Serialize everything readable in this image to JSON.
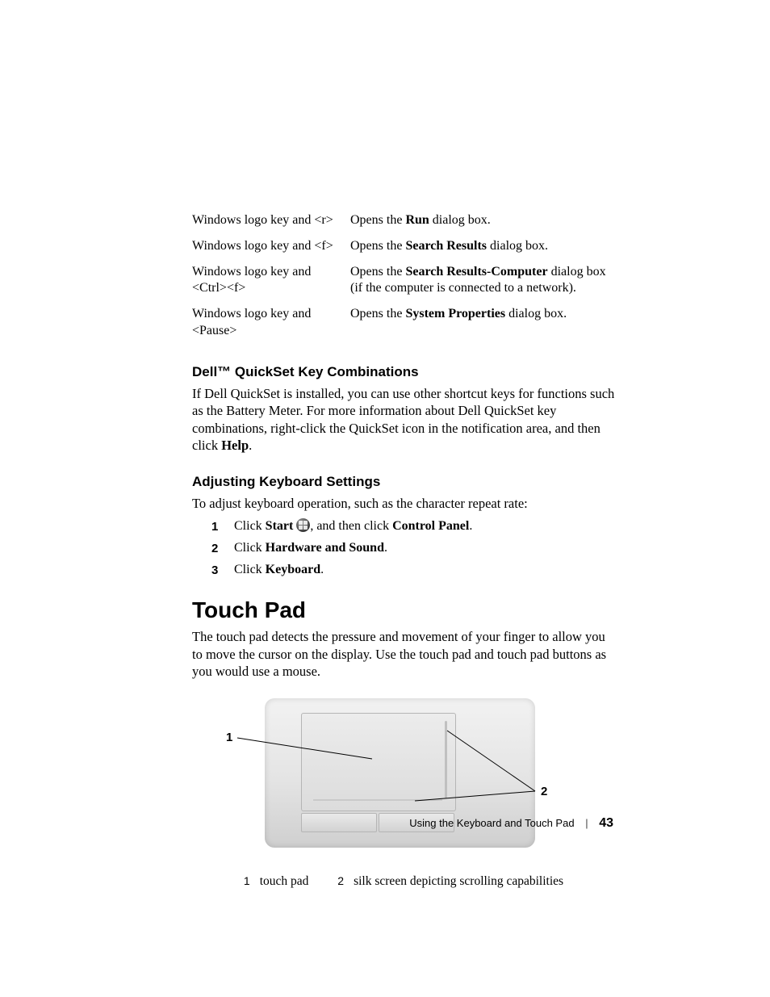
{
  "shortcuts": [
    {
      "keys": "Windows logo key and <r>",
      "desc_pre": "Opens the ",
      "desc_bold": "Run",
      "desc_post": " dialog box."
    },
    {
      "keys": "Windows logo key and <f>",
      "desc_pre": "Opens the ",
      "desc_bold": "Search Results",
      "desc_post": " dialog box."
    },
    {
      "keys": "Windows logo key and <Ctrl><f>",
      "desc_pre": "Opens the ",
      "desc_bold": "Search Results-Computer",
      "desc_post": " dialog box (if the computer is connected to a network)."
    },
    {
      "keys": "Windows logo key and <Pause>",
      "desc_pre": "Opens the ",
      "desc_bold": "System Properties",
      "desc_post": " dialog box."
    }
  ],
  "quickset": {
    "heading": "Dell™ QuickSet Key Combinations",
    "body_pre": "If Dell QuickSet is installed, you can use other shortcut keys for functions such as the Battery Meter. For more information about Dell QuickSet key combinations, right-click the QuickSet icon in the notification area, and then click ",
    "body_bold": "Help",
    "body_post": "."
  },
  "adjusting": {
    "heading": "Adjusting Keyboard Settings",
    "intro": "To adjust keyboard operation, such as the character repeat rate:",
    "steps": [
      {
        "n": "1",
        "pre": "Click ",
        "b1": "Start",
        "mid": " ",
        "orb": true,
        "mid2": ", and then click ",
        "b2": "Control Panel",
        "post": "."
      },
      {
        "n": "2",
        "pre": "Click ",
        "b1": "Hardware and Sound",
        "mid": "",
        "orb": false,
        "mid2": "",
        "b2": "",
        "post": "."
      },
      {
        "n": "3",
        "pre": "Click ",
        "b1": "Keyboard",
        "mid": "",
        "orb": false,
        "mid2": "",
        "b2": "",
        "post": "."
      }
    ]
  },
  "touchpad": {
    "heading": "Touch Pad",
    "body": "The touch pad detects the pressure and movement of your finger to allow you to move the cursor on the display. Use the touch pad and touch pad buttons as you would use a mouse.",
    "callout1": "1",
    "callout2": "2",
    "legend1n": "1",
    "legend1t": "touch pad",
    "legend2n": "2",
    "legend2t": "silk screen depicting scrolling capabilities"
  },
  "footer": {
    "title": "Using the Keyboard and Touch Pad",
    "page": "43"
  }
}
